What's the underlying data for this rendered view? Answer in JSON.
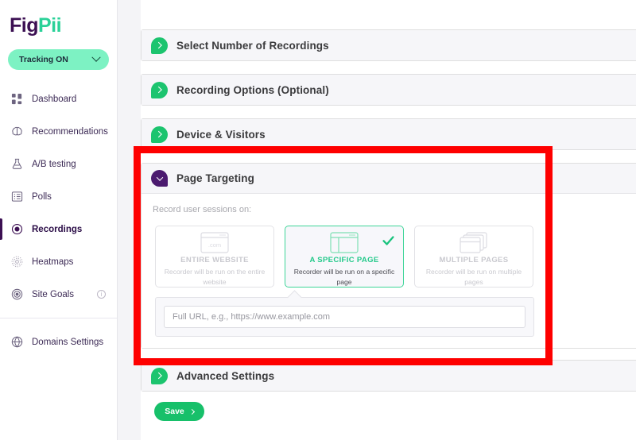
{
  "brand": {
    "logo_fig": "Fig",
    "logo_pii": "Pii",
    "color_purple": "#3c1053",
    "color_green": "#2ad198"
  },
  "sidebar": {
    "tracking": {
      "label": "Tracking ON",
      "icon": "chevron-down-icon"
    },
    "items": [
      {
        "label": "Dashboard",
        "icon": "dashboard-grid-icon",
        "active": false,
        "info": false
      },
      {
        "label": "Recommendations",
        "icon": "brain-icon",
        "active": false,
        "info": false
      },
      {
        "label": "A/B testing",
        "icon": "flask-icon",
        "active": false,
        "info": false
      },
      {
        "label": "Polls",
        "icon": "poll-list-icon",
        "active": false,
        "info": false
      },
      {
        "label": "Recordings",
        "icon": "record-dot-icon",
        "active": true,
        "info": false
      },
      {
        "label": "Heatmaps",
        "icon": "heatmap-icon",
        "active": false,
        "info": false
      },
      {
        "label": "Site Goals",
        "icon": "target-icon",
        "active": false,
        "info": true,
        "info_icon": "info-circle-icon"
      }
    ],
    "footer_items": [
      {
        "label": "Domains Settings",
        "icon": "globe-icon"
      }
    ]
  },
  "main": {
    "accordions": [
      {
        "title": "Select Number of Recordings",
        "icon": "chevron-right-bubble-icon",
        "expanded": false
      },
      {
        "title": "Recording Options (Optional)",
        "icon": "chevron-right-bubble-icon",
        "expanded": false
      },
      {
        "title": "Device & Visitors",
        "icon": "chevron-right-bubble-icon",
        "expanded": false
      }
    ],
    "page_targeting": {
      "title": "Page Targeting",
      "icon": "chevron-down-bubble-icon",
      "expanded": true,
      "record_label": "Record user sessions on:",
      "options": [
        {
          "title": "ENTIRE WEBSITE",
          "description": "Recorder will be run on the entire website",
          "icon": "browser-dotcom-icon",
          "selected": false
        },
        {
          "title": "A SPECIFIC PAGE",
          "description": "Recorder will be run on a specific page",
          "icon": "browser-sidebar-icon",
          "selected": true,
          "check_icon": "checkmark-icon"
        },
        {
          "title": "MULTIPLE PAGES",
          "description": "Recorder will be run on multiple pages",
          "icon": "stacked-windows-icon",
          "selected": false
        }
      ],
      "url_field": {
        "value": "",
        "placeholder": "Full URL, e.g., https://www.example.com"
      }
    },
    "advanced": {
      "title": "Advanced Settings",
      "icon": "chevron-right-bubble-icon",
      "expanded": false
    },
    "save": {
      "label": "Save",
      "icon": "chevron-right-icon"
    }
  },
  "annotation": {
    "color": "#fe0000",
    "shape": "rectangle-outline"
  }
}
